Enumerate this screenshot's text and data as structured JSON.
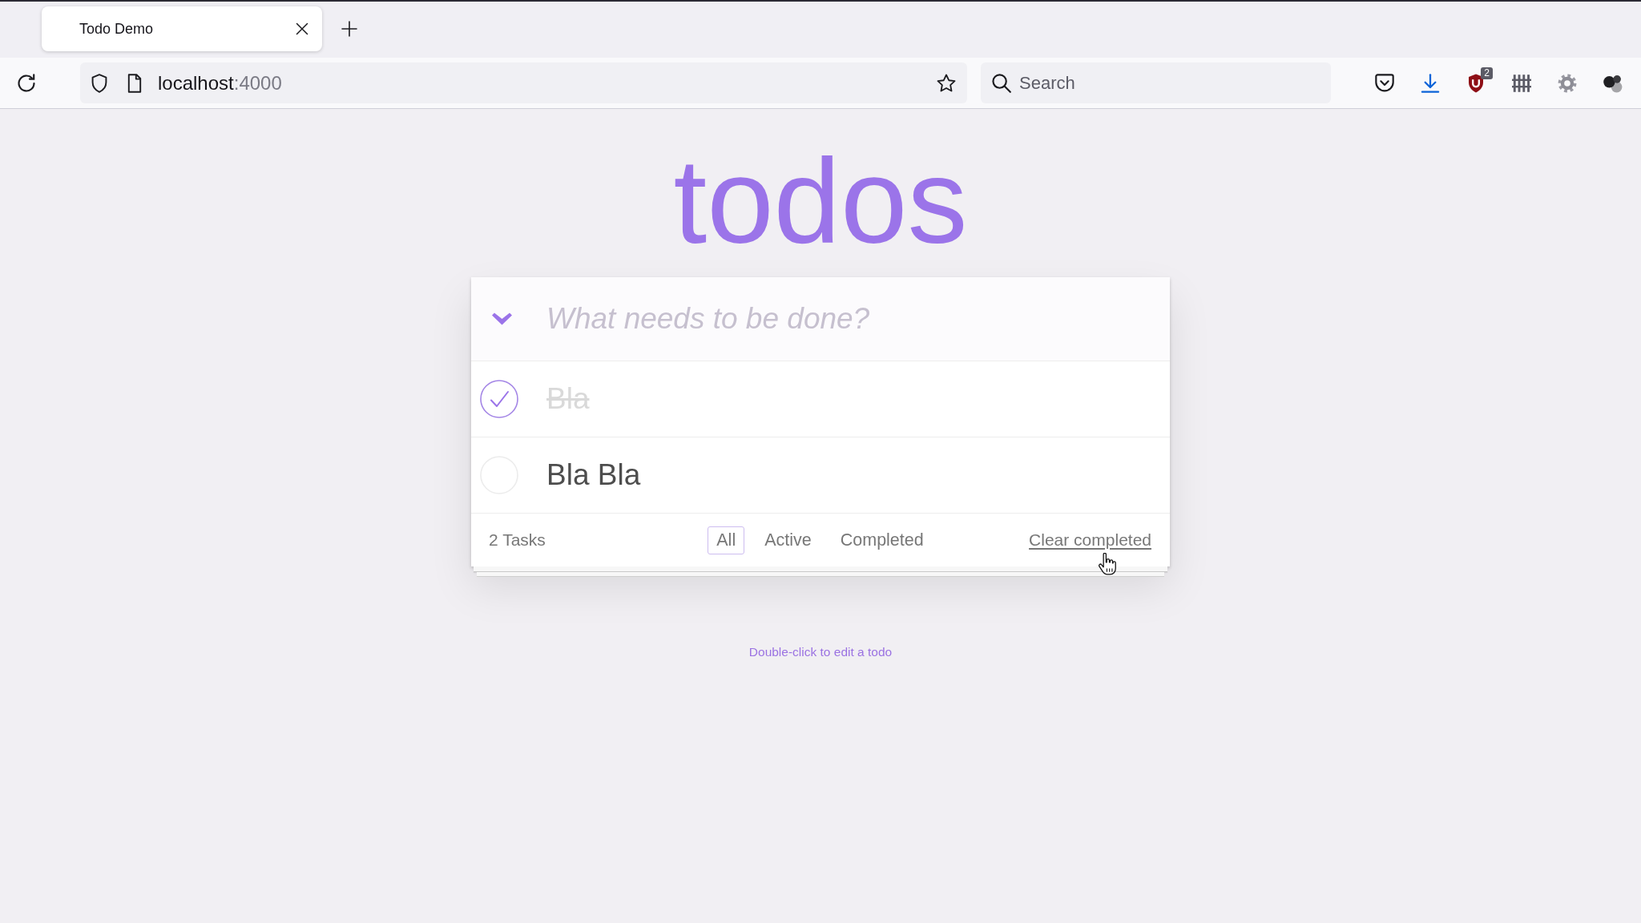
{
  "browser": {
    "tabs": [
      {
        "title": "Todo Demo",
        "selected": true
      }
    ],
    "address_bar": {
      "host": "localhost",
      "port": ":4000"
    },
    "search": {
      "placeholder": "Search"
    },
    "toolbar": {
      "extension_badge": "2"
    }
  },
  "app": {
    "title": "todos",
    "new_todo": {
      "placeholder": "What needs to be done?"
    },
    "todos": [
      {
        "text": "Bla",
        "completed": true
      },
      {
        "text": "Bla Bla",
        "completed": false
      }
    ],
    "footer": {
      "count": "2 Tasks",
      "filters": [
        {
          "label": "All",
          "selected": true
        },
        {
          "label": "Active",
          "selected": false
        },
        {
          "label": "Completed",
          "selected": false
        }
      ],
      "clear_button": "Clear completed"
    },
    "info": "Double-click to edit a todo"
  }
}
